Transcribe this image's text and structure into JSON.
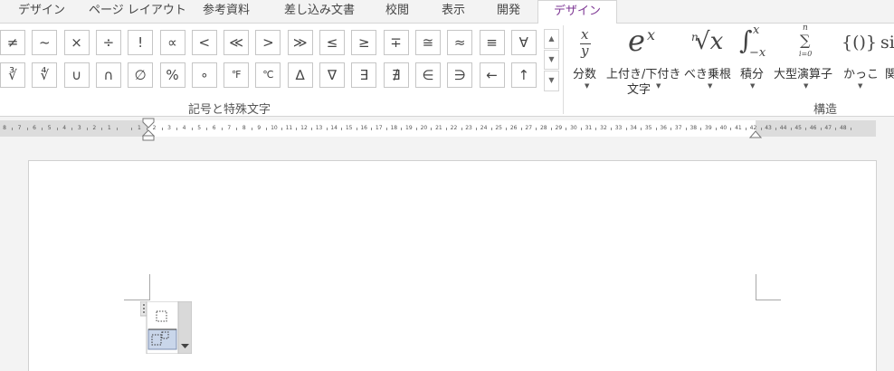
{
  "tabs": [
    "デザイン",
    "ページ レイアウト",
    "参考資料",
    "差し込み文書",
    "校閲",
    "表示",
    "開発",
    "デザイン"
  ],
  "active_tab_index": 7,
  "colors": {
    "accent": "#7e3794",
    "ribbon_bg": "#ffffff",
    "app_bg": "#f3f3f3"
  },
  "symbols": {
    "row1": [
      "≠",
      "~",
      "×",
      "÷",
      "!",
      "∝",
      "<",
      "≪",
      ">",
      "≫",
      "≤",
      "≥",
      "∓",
      "≅",
      "≈",
      "≡",
      "∀"
    ],
    "row2": [
      "∛",
      "∜",
      "∪",
      "∩",
      "∅",
      "%",
      "∘",
      "℉",
      "℃",
      "∆",
      "∇",
      "∃",
      "∄",
      "∈",
      "∋",
      "←",
      "↑"
    ]
  },
  "symbols_group_label": "記号と特殊文字",
  "structures": {
    "fraction": {
      "label": "分数",
      "num": "x",
      "den": "y"
    },
    "script": {
      "label1": "上付き/下付き",
      "label2": "文字",
      "base": "e",
      "sup": "x"
    },
    "radical": {
      "label": "べき乗根",
      "index": "n",
      "body": "√x"
    },
    "integral": {
      "label": "積分",
      "sign": "∫",
      "upper": "x",
      "lower": "−x"
    },
    "large_operator": {
      "label": "大型演算子",
      "sign": "∑",
      "upper": "n",
      "lower": "i=0"
    },
    "bracket": {
      "label": "かっこ",
      "glyph": "{()}"
    },
    "function_partial": {
      "glyph": "si",
      "label": "関"
    },
    "group_label": "構造"
  },
  "ruler_ticks": [
    "8",
    "7",
    "6",
    "5",
    "4",
    "3",
    "2",
    "1",
    "",
    "1",
    "2",
    "3",
    "4",
    "5",
    "6",
    "7",
    "8",
    "9",
    "10",
    "11",
    "12",
    "13",
    "14",
    "15",
    "16",
    "17",
    "18",
    "19",
    "20",
    "21",
    "22",
    "23",
    "24",
    "25",
    "26",
    "27",
    "28",
    "29",
    "30",
    "31",
    "32",
    "33",
    "34",
    "35",
    "36",
    "37",
    "38",
    "39",
    "40",
    "41",
    "42",
    "43",
    "44",
    "45",
    "46",
    "47",
    "48"
  ]
}
